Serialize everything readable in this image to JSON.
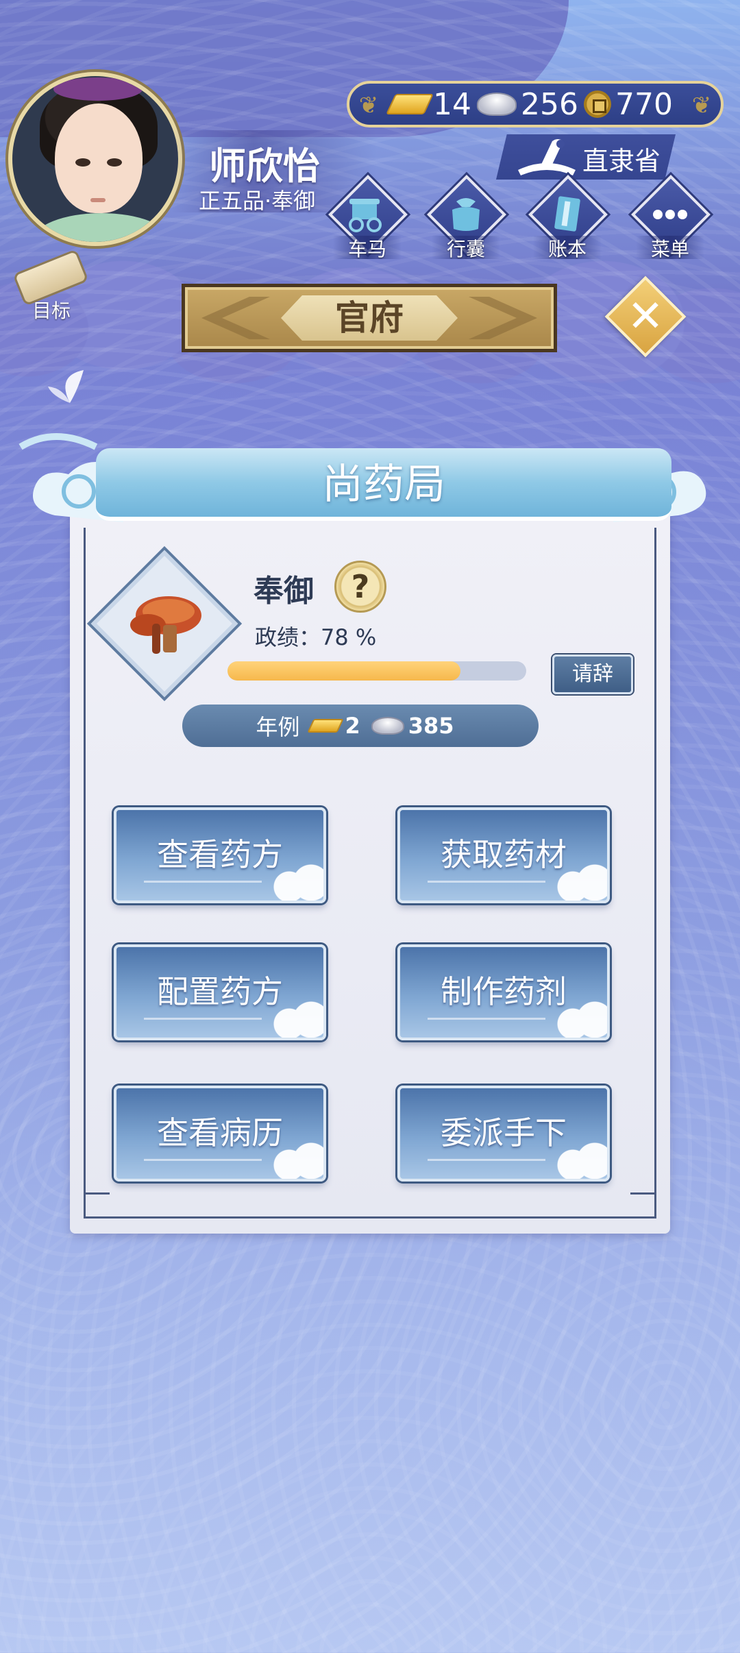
{
  "player": {
    "name": "师欣怡",
    "rank": "正五品·奉御"
  },
  "currency": {
    "gold": "14",
    "silver": "256",
    "coins": "770"
  },
  "province": "直隶省",
  "nav": [
    {
      "label": "车马",
      "icon": "carriage-icon"
    },
    {
      "label": "行囊",
      "icon": "bag-icon"
    },
    {
      "label": "账本",
      "icon": "ledger-icon"
    },
    {
      "label": "菜单",
      "icon": "menu-dots-icon"
    }
  ],
  "goal_label": "目标",
  "plaque_title": "官府",
  "office": {
    "bureau": "尚药局",
    "title": "奉御",
    "help_symbol": "?",
    "merit_label": "政绩：78 %",
    "merit_progress": 0.78,
    "resign_label": "请辞",
    "salary_label": "年例",
    "salary_gold": "2",
    "salary_silver": "385"
  },
  "actions": [
    {
      "label": "查看药方"
    },
    {
      "label": "获取药材"
    },
    {
      "label": "配置药方"
    },
    {
      "label": "制作药剂"
    },
    {
      "label": "查看病历"
    },
    {
      "label": "委派手下"
    }
  ],
  "colors": {
    "accent_gold": "#e6d39a",
    "panel_bg": "#f0f0f7",
    "progress_fill": "#f6b84c",
    "button_blue": "#4c74aa"
  }
}
